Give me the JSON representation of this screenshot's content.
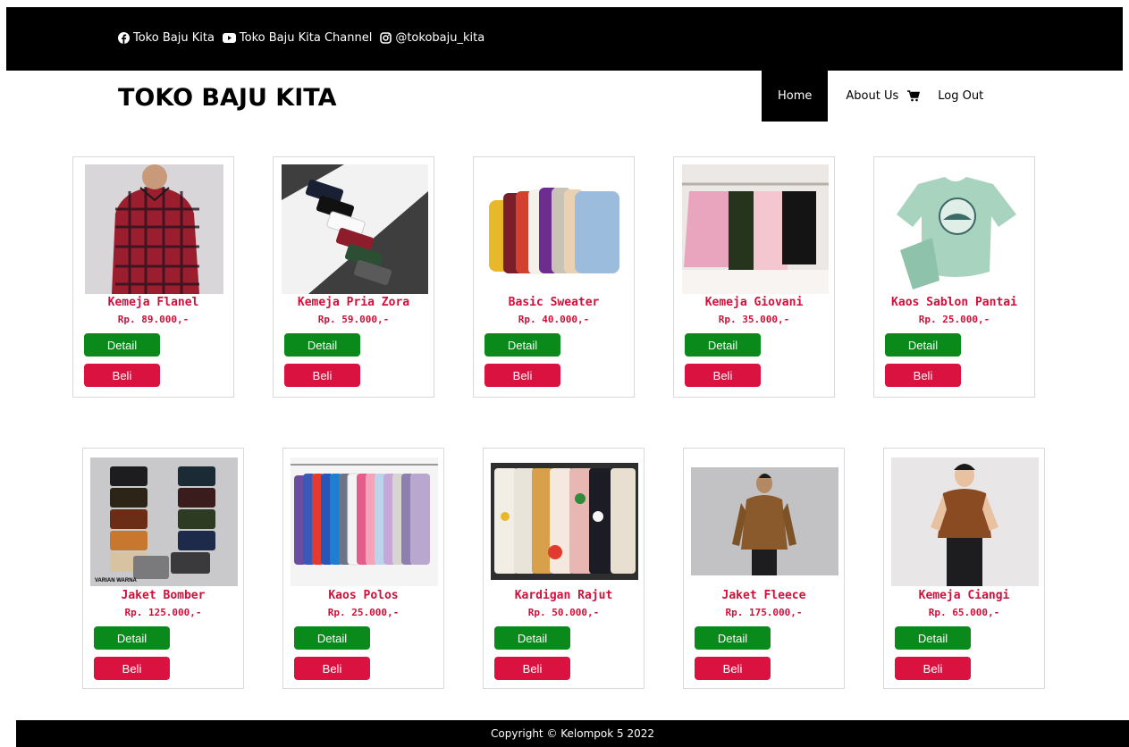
{
  "topbar": {
    "facebook": "Toko Baju Kita",
    "youtube": "Toko Baju Kita Channel",
    "instagram": "@tokobaju_kita"
  },
  "header": {
    "brand": "TOKO BAJU KITA",
    "nav": {
      "home": "Home",
      "about": "About Us",
      "logout": "Log Out"
    }
  },
  "products": [
    {
      "name": "Kemeja Flanel",
      "price": "Rp. 89.000,-",
      "detail": "Detail",
      "buy": "Beli"
    },
    {
      "name": "Kemeja Pria Zora",
      "price": "Rp. 59.000,-",
      "detail": "Detail",
      "buy": "Beli"
    },
    {
      "name": "Basic Sweater",
      "price": "Rp. 40.000,-",
      "detail": "Detail",
      "buy": "Beli"
    },
    {
      "name": "Kemeja Giovani",
      "price": "Rp. 35.000,-",
      "detail": "Detail",
      "buy": "Beli"
    },
    {
      "name": "Kaos Sablon Pantai",
      "price": "Rp. 25.000,-",
      "detail": "Detail",
      "buy": "Beli"
    },
    {
      "name": "Jaket Bomber",
      "price": "Rp. 125.000,-",
      "detail": "Detail",
      "buy": "Beli",
      "image_caption": "VARIAN WARNA"
    },
    {
      "name": "Kaos Polos",
      "price": "Rp. 25.000,-",
      "detail": "Detail",
      "buy": "Beli"
    },
    {
      "name": "Kardigan Rajut",
      "price": "Rp. 50.000,-",
      "detail": "Detail",
      "buy": "Beli"
    },
    {
      "name": "Jaket Fleece",
      "price": "Rp. 175.000,-",
      "detail": "Detail",
      "buy": "Beli"
    },
    {
      "name": "Kemeja Ciangi",
      "price": "Rp. 65.000,-",
      "detail": "Detail",
      "buy": "Beli"
    }
  ],
  "footer": {
    "text": "Copyright © Kelompok 5 2022"
  },
  "colors": {
    "accent": "#d0103a",
    "detail_button": "#0a8a1a",
    "buy_button": "#d9123f",
    "bar": "#000000"
  }
}
